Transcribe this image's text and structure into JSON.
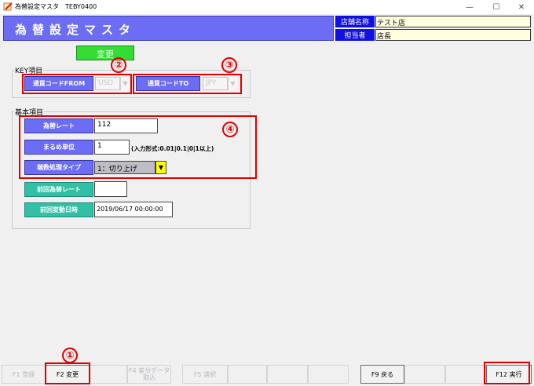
{
  "window": {
    "title": "為替設定マスタ　TEBY0400",
    "minimize": "—",
    "maximize": "☐",
    "close": "✕"
  },
  "header": {
    "title": "為替設定マスタ",
    "store_label": "店舗名称",
    "store_value": "テスト店",
    "person_label": "担当者",
    "person_value": "店長"
  },
  "mode_badge": "変更",
  "key_section": {
    "title": "KEY項目",
    "currency_from_label": "通貨コードFROM",
    "currency_from_value": "USD",
    "currency_to_label": "通貨コードTO",
    "currency_to_value": "JPY"
  },
  "basic_section": {
    "title": "基本項目",
    "rate_label": "為替レート",
    "rate_value": "112",
    "rounding_unit_label": "まるめ単位",
    "rounding_unit_value": "1",
    "rounding_unit_hint": "(入力形式:0.01|0.1|0|1以上)",
    "fraction_type_label": "端数処理タイプ",
    "fraction_type_value": "1：切り上げ",
    "prev_rate_label": "前回為替レート",
    "prev_rate_value": "",
    "prev_changed_label": "前回変動日時",
    "prev_changed_value": "2019/06/17 00:00:00"
  },
  "annotations": {
    "n1": "①",
    "n2": "②",
    "n3": "③",
    "n4": "④"
  },
  "fkeys": {
    "f1": "F1 登録",
    "f2": "F2 変更",
    "f4_line1": "F4 差分データ",
    "f4_line2": "取込",
    "f5": "F5 選択",
    "f9": "F9 戻る",
    "f12": "F12 実行"
  },
  "colors": {
    "header_bg": "#6c6cf5",
    "info_label_bg": "#1010e0",
    "mode_badge_bg": "#33dd33",
    "label_teal": "#31bfa6",
    "highlight_red": "#e00000"
  }
}
